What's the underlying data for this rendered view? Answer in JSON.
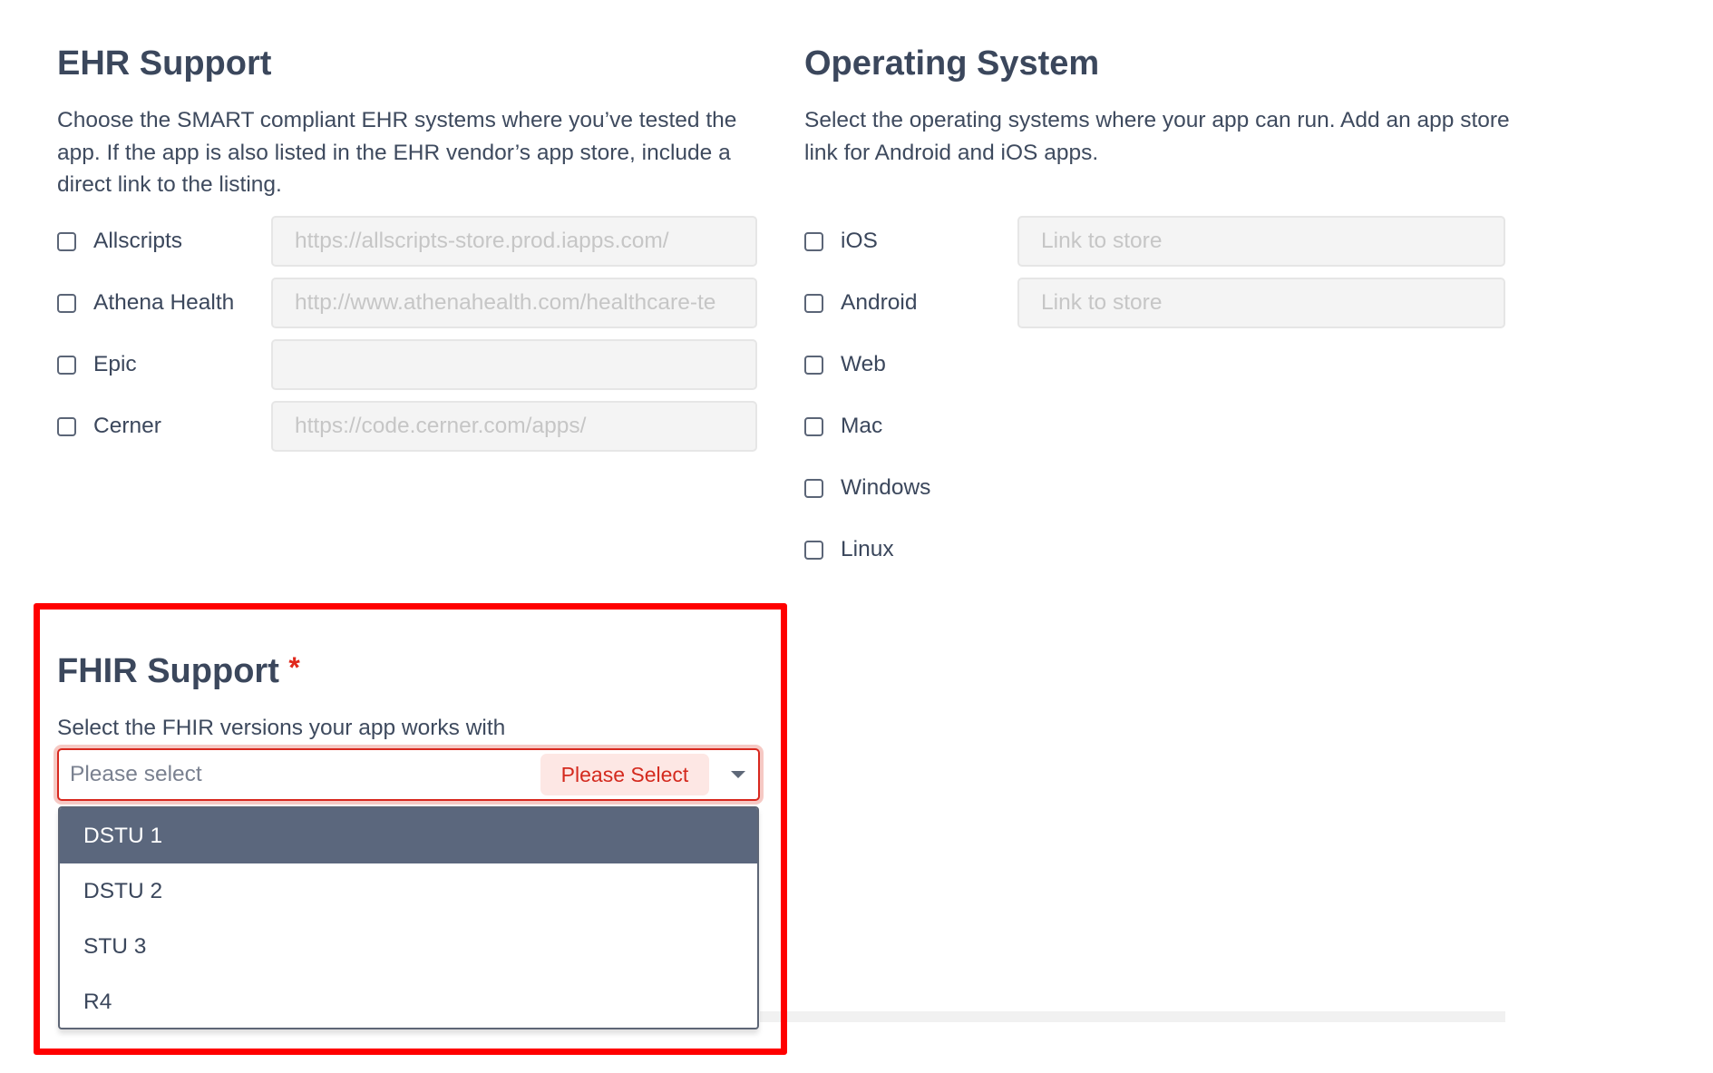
{
  "ehr": {
    "title": "EHR Support",
    "description": "Choose the SMART compliant EHR systems where you’ve tested the app. If the app is also listed in the EHR vendor’s app store, include a direct link to the listing.",
    "items": [
      {
        "label": "Allscripts",
        "checked": false,
        "link_placeholder": "https://allscripts-store.prod.iapps.com/",
        "link_value": ""
      },
      {
        "label": "Athena Health",
        "checked": false,
        "link_placeholder": "http://www.athenahealth.com/healthcare-te",
        "link_value": ""
      },
      {
        "label": "Epic",
        "checked": false,
        "link_placeholder": "",
        "link_value": ""
      },
      {
        "label": "Cerner",
        "checked": false,
        "link_placeholder": "https://code.cerner.com/apps/",
        "link_value": ""
      }
    ]
  },
  "os": {
    "title": "Operating System",
    "description": "Select the operating systems where your app can run. Add an app store link for Android and iOS apps.",
    "items": [
      {
        "label": "iOS",
        "checked": false,
        "link_placeholder": "Link to store"
      },
      {
        "label": "Android",
        "checked": false,
        "link_placeholder": "Link to store"
      },
      {
        "label": "Web",
        "checked": false
      },
      {
        "label": "Mac",
        "checked": false
      },
      {
        "label": "Windows",
        "checked": false
      },
      {
        "label": "Linux",
        "checked": false
      }
    ]
  },
  "fhir": {
    "title": "FHIR Support",
    "required_marker": "*",
    "description": "Select the FHIR versions your app works with",
    "select": {
      "placeholder": "Please select",
      "validation_message": "Please Select",
      "options": [
        "DSTU 1",
        "DSTU 2",
        "STU 3",
        "R4"
      ],
      "highlighted_option": "DSTU 1"
    }
  },
  "colors": {
    "text": "#3b475c",
    "error": "#d42a1e",
    "error_bg": "#fde7e4",
    "highlight": "#5b677d",
    "annotation_box": "#ff0000"
  }
}
